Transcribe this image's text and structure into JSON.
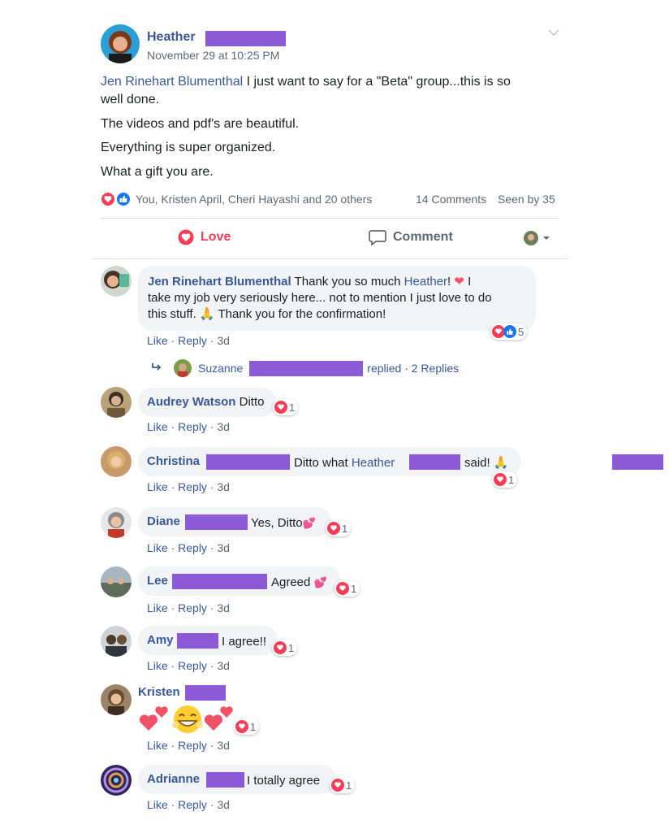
{
  "post": {
    "author": "Heather",
    "timestamp": "November 29 at 10:25 PM",
    "mention": "Jen Rinehart Blumenthal",
    "line1_rest": " I just want to say for a \"Beta\" group...this is so",
    "line1b": "well done.",
    "line2": "The videos and pdf's are beautiful.",
    "line3": "Everything is super organized.",
    "line4": "What a gift you are.",
    "reactions_names": "You, Kristen April, Cheri Hayashi and 20 others",
    "comments_count": "14 Comments",
    "seen_by": "Seen by 35"
  },
  "actions": {
    "love": "Love",
    "comment": "Comment"
  },
  "meta": {
    "like": "Like",
    "reply": "Reply",
    "sep": " · ",
    "age": "3d"
  },
  "comments": [
    {
      "name": "Jen Rinehart Blumenthal",
      "text1_a": " Thank you so much ",
      "text1_mention": "Heather",
      "text1_b": "! ",
      "text1_c": " I",
      "text2": "take my job very seriously here... not to mention I just love to do",
      "text3_a": "this stuff. ",
      "text3_b": " Thank you for the confirmation!",
      "reaction_count": "5"
    },
    {
      "name": "Audrey Watson",
      "text": " Ditto",
      "reaction_count": "1"
    },
    {
      "name": "Christina",
      "text_a": "Ditto what ",
      "mention": "Heather",
      "text_b": "said! ",
      "reaction_count": "1"
    },
    {
      "name": "Diane",
      "text": "Yes, Ditto",
      "reaction_count": "1"
    },
    {
      "name": "Lee",
      "text": "Agreed ",
      "reaction_count": "1"
    },
    {
      "name": "Amy",
      "text": "I agree!!",
      "reaction_count": "1"
    },
    {
      "name": "Kristen",
      "reaction_count": "1"
    },
    {
      "name": "Adrianne",
      "text": "I totally agree",
      "reaction_count": "1"
    }
  ],
  "reply_summary": {
    "name": "Suzanne",
    "text": "replied · 2 Replies"
  },
  "colors": {
    "link": "#385898",
    "love": "#f33e58",
    "like": "#1877f2",
    "redaction": "#8c5ad6",
    "bubble": "#f2f3f5"
  },
  "icons": [
    "chevron-down-icon",
    "heart-icon",
    "like-icon",
    "comment-icon",
    "reply-arrow-icon",
    "praying-hands-emoji",
    "two-hearts-emoji",
    "smiling-face-emoji"
  ]
}
